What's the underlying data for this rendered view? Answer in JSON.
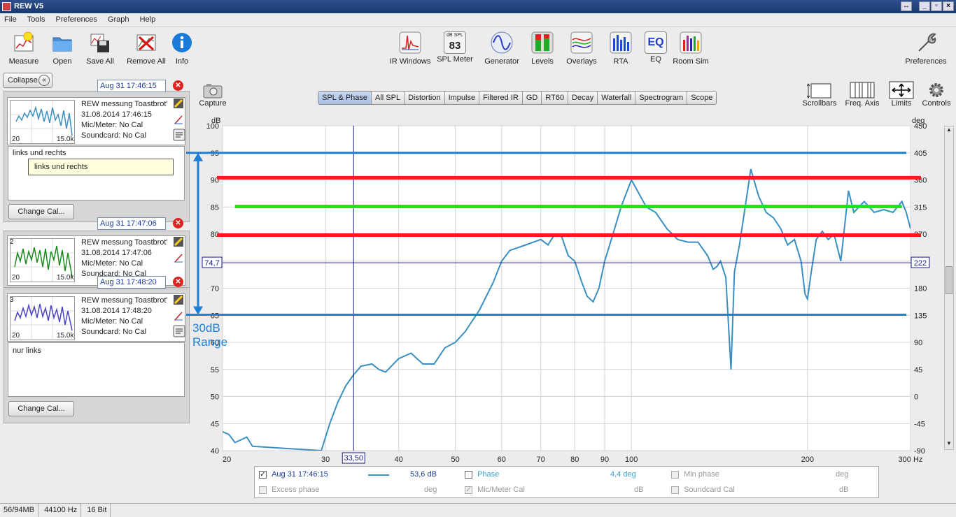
{
  "window": {
    "title": "REW V5"
  },
  "menu": [
    "File",
    "Tools",
    "Preferences",
    "Graph",
    "Help"
  ],
  "toolbar_left": [
    {
      "label": "Measure",
      "icon": "measure-icon"
    },
    {
      "label": "Open",
      "icon": "folder-icon"
    },
    {
      "label": "Save All",
      "icon": "save-icon"
    },
    {
      "label": "Remove All",
      "icon": "remove-icon"
    },
    {
      "label": "Info",
      "icon": "info-icon"
    }
  ],
  "toolbar_center": [
    {
      "label": "IR Windows",
      "icon": "ir-windows-icon"
    },
    {
      "label": "SPL Meter",
      "icon": "spl-meter-icon",
      "value": "83",
      "caption": "dB SPL"
    },
    {
      "label": "Generator",
      "icon": "generator-icon"
    },
    {
      "label": "Levels",
      "icon": "levels-icon"
    },
    {
      "label": "Overlays",
      "icon": "overlays-icon"
    },
    {
      "label": "RTA",
      "icon": "rta-icon"
    },
    {
      "label": "EQ",
      "icon": "eq-icon",
      "value": "EQ"
    },
    {
      "label": "Room Sim",
      "icon": "room-sim-icon"
    }
  ],
  "toolbar_right": {
    "label": "Preferences",
    "icon": "wrench-icon"
  },
  "collapse_label": "Collapse",
  "capture_label": "Capture",
  "graph_tabs": [
    "SPL & Phase",
    "All SPL",
    "Distortion",
    "Impulse",
    "Filtered IR",
    "GD",
    "RT60",
    "Decay",
    "Waterfall",
    "Spectrogram",
    "Scope"
  ],
  "graph_controls": [
    {
      "label": "Scrollbars",
      "icon": "scrollbars-icon"
    },
    {
      "label": "Freq. Axis",
      "icon": "freq-axis-icon"
    },
    {
      "label": "Limits",
      "icon": "limits-icon"
    },
    {
      "label": "Controls",
      "icon": "gear-icon"
    }
  ],
  "measurements": [
    {
      "index": "1",
      "date": "Aug 31 17:46:15",
      "name": "REW messung Toastbrot'",
      "timestamp": "31.08.2014 17:46:15",
      "mic": "Mic/Meter: No Cal",
      "soundcard": "Soundcard: No Cal",
      "notes": "links und rechts",
      "tooltip": "links und rechts",
      "thumb_left": "20",
      "thumb_right": "15.0k",
      "color": "#3a8fc0",
      "change_cal": "Change Cal..."
    },
    {
      "index": "2",
      "date": "Aug 31 17:47:06",
      "name": "REW messung Toastbrot'",
      "timestamp": "31.08.2014 17:47:06",
      "mic": "Mic/Meter: No Cal",
      "soundcard": "Soundcard: No Cal",
      "thumb_left": "20",
      "thumb_right": "15.0k",
      "color": "#1a8a1a"
    },
    {
      "index": "3",
      "date": "Aug 31 17:48:20",
      "name": "REW messung Toastbrot'",
      "timestamp": "31.08.2014 17:48:20",
      "mic": "Mic/Meter: No Cal",
      "soundcard": "Soundcard: No Cal",
      "notes": "nur links",
      "thumb_left": "20",
      "thumb_right": "15.0k",
      "color": "#4a44c4",
      "change_cal": "Change Cal..."
    }
  ],
  "annotation": {
    "line1": "30dB",
    "line2": "Range"
  },
  "cursor": {
    "x_readout": "33,50",
    "y_left_readout": "74,7",
    "y_right_readout": "222"
  },
  "chart_data": {
    "type": "line",
    "x_label": "Hz",
    "y_label_left": "dB",
    "y_label_right": "deg",
    "x_scale": "log",
    "xlim": [
      20,
      300
    ],
    "ylim_left": [
      40,
      100
    ],
    "ylim_right": [
      -90,
      450
    ],
    "x_ticks": [
      20,
      30,
      40,
      50,
      60,
      70,
      80,
      90,
      100,
      200,
      300
    ],
    "x_tick_labels": [
      "20",
      "30",
      "40",
      "50",
      "60",
      "70",
      "80",
      "90",
      "100",
      "200",
      "300 Hz"
    ],
    "y_ticks_left": [
      40,
      45,
      50,
      55,
      60,
      65,
      70,
      75,
      80,
      85,
      90,
      95,
      100
    ],
    "y_ticks_right": [
      -90,
      -45,
      0,
      45,
      90,
      135,
      180,
      225,
      270,
      315,
      360,
      405,
      450
    ],
    "grid": true,
    "cursor_x": 33.5,
    "cursor_y": 74.7,
    "series": [
      {
        "name": "Aug 31 17:46:15",
        "color": "#3a8fc0",
        "x": [
          20,
          20.5,
          21,
          21.5,
          22,
          22.5,
          29.5,
          30.5,
          31.5,
          32.5,
          33.5,
          34.5,
          36,
          37,
          38,
          40,
          42,
          44,
          46,
          48,
          50,
          52,
          55,
          58,
          60,
          62,
          64,
          66,
          68,
          70,
          72,
          74,
          76,
          78,
          80,
          82,
          84,
          86,
          88,
          90,
          93,
          96,
          100,
          103,
          106,
          110,
          115,
          120,
          125,
          130,
          135,
          138,
          140,
          142,
          145,
          148,
          150,
          153,
          156,
          160,
          165,
          170,
          175,
          180,
          185,
          190,
          195,
          198,
          200,
          203,
          207,
          212,
          217,
          222,
          228,
          235,
          240,
          250,
          260,
          270,
          280,
          290,
          295,
          300
        ],
        "y": [
          43.5,
          43,
          41.5,
          42,
          42.5,
          40.8,
          40,
          45,
          49,
          52,
          54,
          55.6,
          56,
          55,
          54.5,
          57,
          58,
          56,
          56,
          59,
          60,
          62,
          66,
          71,
          75,
          77,
          77.5,
          78,
          78.5,
          79,
          78,
          80,
          79.5,
          76,
          75,
          71.5,
          68.5,
          67.5,
          70,
          75,
          80,
          85,
          90,
          87.5,
          85,
          84,
          81,
          79,
          78.5,
          78.5,
          76,
          73.5,
          74,
          75,
          72,
          55,
          73,
          78,
          84,
          92,
          87,
          84,
          83,
          81,
          78,
          79,
          75,
          69,
          68,
          73,
          79,
          80.5,
          79,
          80,
          75,
          88,
          84,
          86,
          84,
          84.5,
          84,
          86,
          84,
          81
        ]
      }
    ],
    "overlay_lines": [
      {
        "color": "#1e7ed8",
        "value": 95
      },
      {
        "color": "#ff1a1a",
        "value": 90.4
      },
      {
        "color": "#22e022",
        "value": 85.1
      },
      {
        "color": "#ff1a1a",
        "value": 79.8
      },
      {
        "color": "#1e7ed8",
        "value": 65.1
      }
    ]
  },
  "legend": {
    "row1": [
      {
        "label": "Aug 31 17:46:15",
        "checked": true,
        "value": "53,6 dB"
      },
      {
        "label": "Phase",
        "checked": false,
        "value": "4,4 deg"
      },
      {
        "label": "Min phase",
        "checked": false,
        "disabled": true,
        "value": "deg"
      }
    ],
    "row2": [
      {
        "label": "Excess phase",
        "checked": false,
        "disabled": true,
        "value": "deg"
      },
      {
        "label": "Mic/Meter Cal",
        "checked": true,
        "disabled": true,
        "value": "dB"
      },
      {
        "label": "Soundcard Cal",
        "checked": false,
        "disabled": true,
        "value": "dB"
      }
    ]
  },
  "status": [
    "56/94MB",
    "44100 Hz",
    "16 Bit"
  ]
}
